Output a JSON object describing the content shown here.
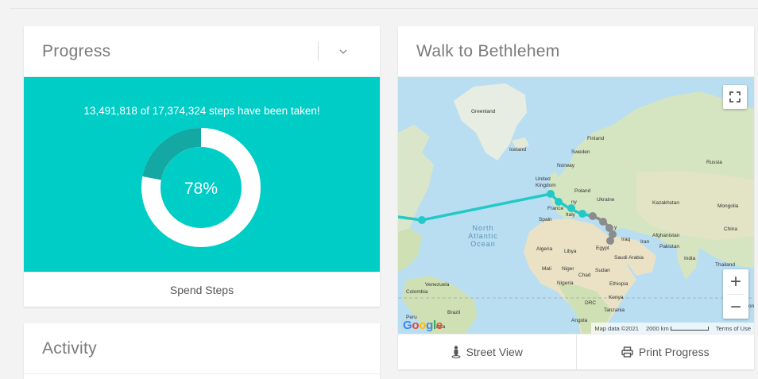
{
  "progress": {
    "title": "Progress",
    "steps_text": "13,491,818 of 17,374,324 steps have been taken!",
    "percent_label": "78%",
    "percent_value": 0.78,
    "spend_button": "Spend Steps"
  },
  "activity": {
    "title": "Activity"
  },
  "walk": {
    "title": "Walk to Bethlehem",
    "street_view": "Street View",
    "print_progress": "Print Progress"
  },
  "map": {
    "labels": {
      "greenland": "Greenland",
      "iceland": "Iceland",
      "finland": "Finland",
      "sweden": "Sweden",
      "norway": "Norway",
      "russia": "Russia",
      "united_kingdom": "United\nKingdom",
      "poland": "Poland",
      "ukraine": "Ukraine",
      "kazakhstan": "Kazakhstan",
      "mongolia": "Mongolia",
      "france": "France",
      "germany": "ny",
      "italy": "Italy",
      "spain": "Spain",
      "turkey": "y",
      "china": "China",
      "iraq": "Iraq",
      "iran": "Iran",
      "afghanistan": "Afghanistan",
      "pakistan": "Pakistan",
      "algeria": "Algeria",
      "libya": "Libya",
      "egypt": "Egypt",
      "saudi_arabia": "Saudi Arabia",
      "india": "India",
      "thailand": "Thailand",
      "mali": "Mali",
      "niger": "Niger",
      "chad": "Chad",
      "sudan": "Sudan",
      "nigeria": "Nigeria",
      "ethiopia": "Ethiopia",
      "venezuela": "Venezuela",
      "colombia": "Colombia",
      "kenya": "Kenya",
      "drc": "DRC",
      "tanzania": "Tanzania",
      "peru": "Peru",
      "brazil": "Brazil",
      "bolivia": "livia",
      "angola": "Angola",
      "ocean": "North\nAtlantic\nOcean",
      "edge_on": "on"
    },
    "attribution": "Map data ©2021",
    "scale": "2000 km",
    "terms": "Terms of Use",
    "google": "Google",
    "zoom_in": "+",
    "zoom_out": "−"
  },
  "colors": {
    "accent": "#00cdc6",
    "donut_dark": "#13a8a2",
    "route_traveled": "#23c9c6",
    "route_remaining": "#8c8c8c"
  }
}
